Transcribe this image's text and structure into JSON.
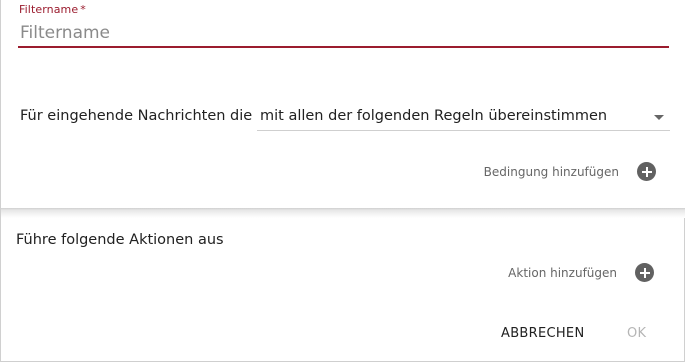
{
  "filter": {
    "label": "Filtername",
    "required_marker": "*",
    "placeholder": "Filtername",
    "value": ""
  },
  "rule": {
    "prefix": "Für eingehende Nachrichten die",
    "selected": "mit allen der folgenden Regeln übereinstimmen",
    "add_condition_label": "Bedingung hinzufügen"
  },
  "actions": {
    "heading": "Führe folgende Aktionen aus",
    "add_action_label": "Aktion hinzufügen"
  },
  "footer": {
    "cancel_label": "ABBRECHEN",
    "ok_label": "OK"
  },
  "colors": {
    "accent": "#9b1c2e",
    "icon": "#616161",
    "disabled": "#b5b5b5"
  },
  "icons": {
    "dropdown": "caret-down-icon",
    "add": "plus-circle-icon"
  }
}
